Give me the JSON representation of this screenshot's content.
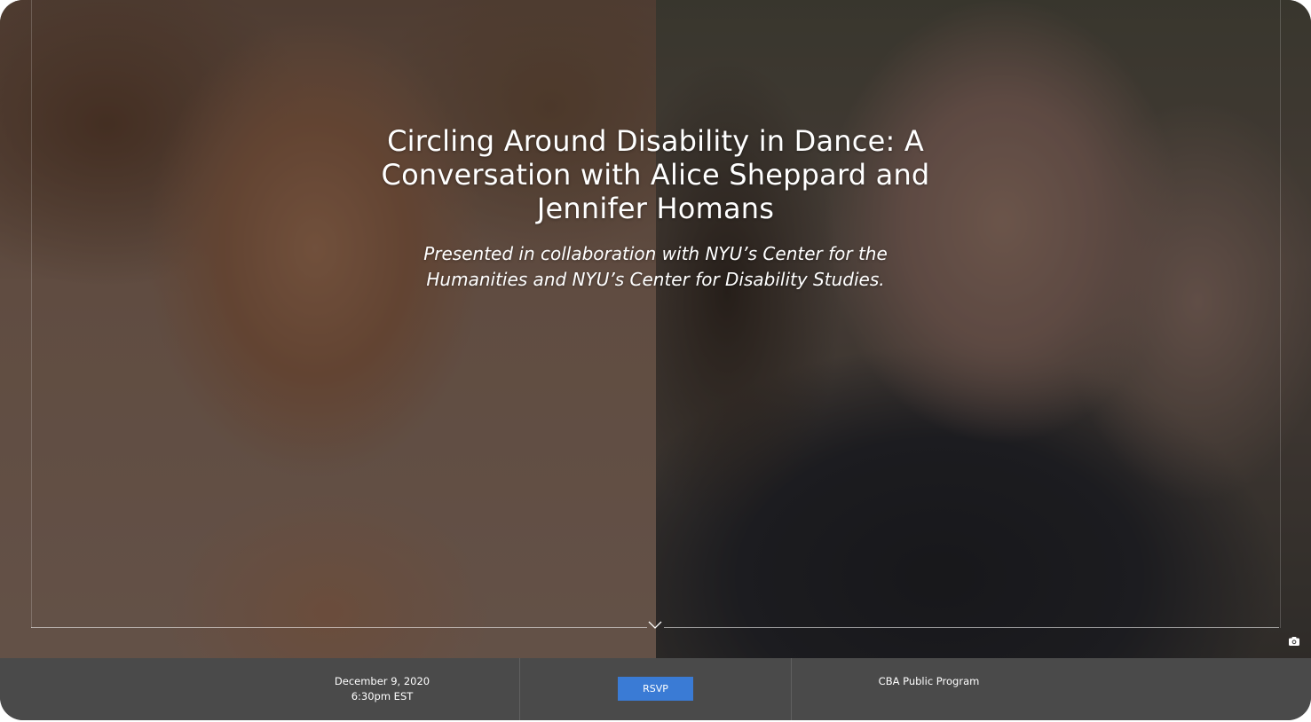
{
  "hero": {
    "title": "Circling Around Disability in Dance: A Conversation with Alice Sheppard and Jennifer Homans",
    "subtitle_prefix": "Presented in collaboration with ",
    "subtitle_org1": "NYU’s Center for the Humanities",
    "subtitle_and": " and ",
    "subtitle_org2": "NYU’s Center for Disability Studies",
    "subtitle_suffix": ".",
    "left_photo_icon": "portrait-alice-sheppard",
    "right_photo_icon": "portrait-jennifer-homans",
    "scroll_icon": "chevron-down-icon",
    "camera_icon": "camera-icon"
  },
  "info_bar": {
    "date": "December 9, 2020",
    "time": "6:30pm EST",
    "rsvp_label": "RSVP",
    "program_label": "CBA Public Program"
  },
  "colors": {
    "bar_background": "#4a4a4a",
    "button_blue": "#3a7bd5",
    "text": "#ffffff"
  }
}
